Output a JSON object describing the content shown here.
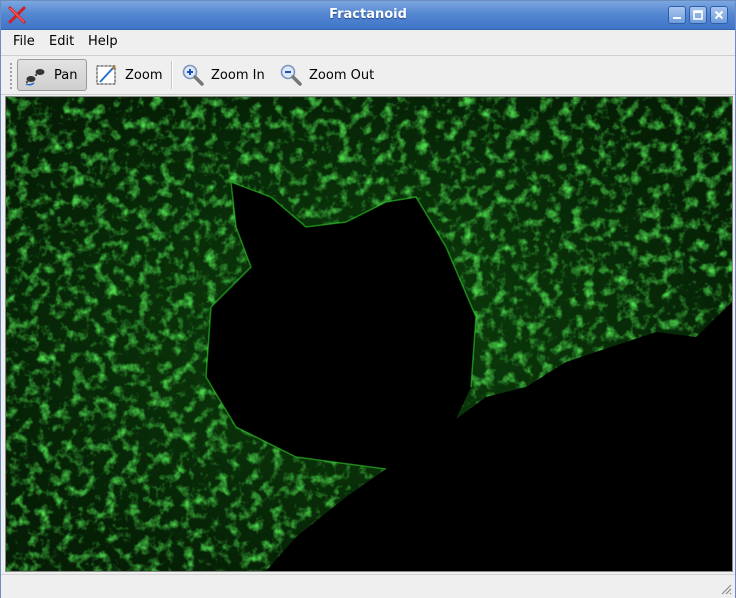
{
  "window": {
    "title": "Fractanoid"
  },
  "menu": {
    "items": [
      "File",
      "Edit",
      "Help"
    ]
  },
  "toolbar": {
    "pan_label": "Pan",
    "zoom_label": "Zoom",
    "zoom_in_label": "Zoom In",
    "zoom_out_label": "Zoom Out",
    "active_tool": "Pan"
  },
  "canvas": {
    "colors": {
      "background": "#000000",
      "fractal": "#22c81e",
      "haze": "#0b3a0a"
    }
  },
  "icons": [
    "app-x-icon",
    "minimize-icon",
    "maximize-icon",
    "close-icon",
    "pan-icon",
    "zoom-rect-icon",
    "zoom-in-icon",
    "zoom-out-icon",
    "resize-grip-icon"
  ]
}
